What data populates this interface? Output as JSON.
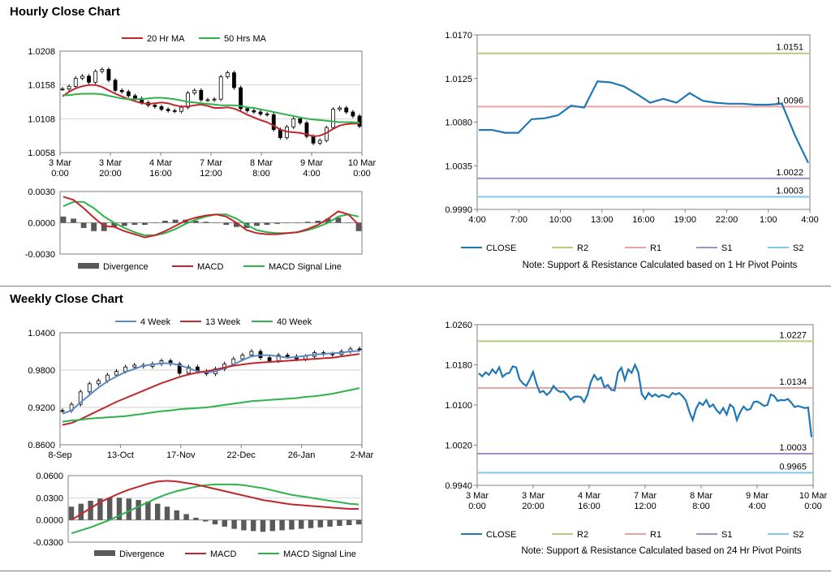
{
  "sections": {
    "hourly_title": "Hourly Close Chart",
    "weekly_title": "Weekly Close Chart"
  },
  "colors": {
    "ma20": "#c0272d",
    "ma50": "#2db34a",
    "wk4": "#5a8ac6",
    "wk13": "#c0272d",
    "wk40": "#2db34a",
    "close": "#1f77b4",
    "r2": "#b5cc7a",
    "r1": "#e7a3a3",
    "s1": "#a48fc0",
    "s2": "#7fc8e6",
    "divergence": "#595959",
    "macd": "#c0272d",
    "signal": "#2db34a"
  },
  "chart_data": [
    {
      "id": "hourly_price",
      "type": "candlestick",
      "title": "",
      "legend": [
        "20 Hr MA",
        "50 Hrs MA"
      ],
      "legend_placement": "top",
      "yticks": [
        "1.0208",
        "1.0158",
        "1.0108",
        "1.0058"
      ],
      "ylim": [
        1.0058,
        1.0208
      ],
      "xticks": [
        [
          "3 Mar",
          "0:00"
        ],
        [
          "3 Mar",
          "20:00"
        ],
        [
          "4 Mar",
          "16:00"
        ],
        [
          "7 Mar",
          "12:00"
        ],
        [
          "8 Mar",
          "8:00"
        ],
        [
          "9 Mar",
          "4:00"
        ],
        [
          "10 Mar",
          "0:00"
        ]
      ],
      "close": [
        1.0152,
        1.0156,
        1.0168,
        1.0171,
        1.0162,
        1.0178,
        1.0181,
        1.0165,
        1.015,
        1.0148,
        1.0142,
        1.0138,
        1.0132,
        1.0128,
        1.0126,
        1.0122,
        1.012,
        1.0119,
        1.0125,
        1.0146,
        1.015,
        1.0136,
        1.0136,
        1.0137,
        1.017,
        1.0176,
        1.0154,
        1.0123,
        1.012,
        1.0118,
        1.0115,
        1.0114,
        1.0092,
        1.008,
        1.0096,
        1.0108,
        1.0102,
        1.0082,
        1.0072,
        1.0076,
        1.0095,
        1.0122,
        1.0124,
        1.0118,
        1.0112,
        1.0097
      ],
      "ma20": [
        1.0141,
        1.0148,
        1.0153,
        1.0156,
        1.0158,
        1.0158,
        1.0155,
        1.015,
        1.0145,
        1.0141,
        1.0137,
        1.0134,
        1.0131,
        1.013,
        1.0131,
        1.0132,
        1.0131,
        1.0128,
        1.0126,
        1.0126,
        1.0128,
        1.0129,
        1.0127,
        1.0124,
        1.0124,
        1.0125,
        1.0123,
        1.0119,
        1.0114,
        1.011,
        1.0106,
        1.0103,
        1.0098,
        1.0092,
        1.0089,
        1.0088,
        1.0087,
        1.0085,
        1.0082,
        1.0083,
        1.0087,
        1.0093,
        1.0098,
        1.01,
        1.0101,
        1.0101
      ],
      "ma50": [
        1.0143,
        1.0143,
        1.0144,
        1.0145,
        1.0145,
        1.0145,
        1.0144,
        1.0142,
        1.014,
        1.0138,
        1.0137,
        1.0137,
        1.0137,
        1.0138,
        1.0139,
        1.0139,
        1.0138,
        1.0137,
        1.0135,
        1.0133,
        1.0132,
        1.0131,
        1.013,
        1.0129,
        1.0128,
        1.0128,
        1.0128,
        1.0127,
        1.0125,
        1.0124,
        1.0122,
        1.012,
        1.0118,
        1.0116,
        1.0114,
        1.0112,
        1.011,
        1.0108,
        1.0107,
        1.0106,
        1.0105,
        1.0104,
        1.0103,
        1.0103,
        1.0103,
        1.0102
      ]
    },
    {
      "id": "hourly_macd",
      "type": "line",
      "legend": [
        "Divergence",
        "MACD",
        "MACD Signal Line"
      ],
      "yticks": [
        "0.0030",
        "0.0000",
        "-0.0030"
      ],
      "ylim": [
        -0.003,
        0.003
      ],
      "macd": [
        0.0025,
        0.0022,
        0.0014,
        0.0005,
        -0.0003,
        -0.0004,
        -0.0008,
        -0.0011,
        -0.0014,
        -0.0012,
        -0.0008,
        -0.0003,
        0.0002,
        0.0005,
        0.0007,
        0.0008,
        0.0006,
        0.0,
        -0.0007,
        -0.001,
        -0.0011,
        -0.0011,
        -0.001,
        -0.0009,
        -0.0006,
        -0.0002,
        0.0004,
        0.0011,
        0.0008,
        -0.0002
      ],
      "signal": [
        0.0016,
        0.002,
        0.002,
        0.0014,
        0.0006,
        0.0,
        -0.0005,
        -0.0009,
        -0.0012,
        -0.0012,
        -0.001,
        -0.0006,
        -0.0001,
        0.0003,
        0.0006,
        0.0008,
        0.0008,
        0.0004,
        -0.0002,
        -0.0007,
        -0.0009,
        -0.001,
        -0.001,
        -0.0009,
        -0.0007,
        -0.0004,
        0.0,
        0.0006,
        0.0008,
        0.0006
      ],
      "divergence": [
        0.0006,
        0.0004,
        -0.0005,
        -0.0008,
        -0.0008,
        -0.0004,
        -0.0003,
        -0.0002,
        -0.0002,
        0.0,
        0.0002,
        0.0003,
        0.0003,
        0.0002,
        0.0001,
        0.0,
        -0.0002,
        -0.0004,
        -0.0005,
        -0.0003,
        -0.0002,
        -0.0001,
        0.0,
        0.0,
        0.0001,
        0.0002,
        0.0004,
        0.0005,
        0.0,
        -0.0008
      ]
    },
    {
      "id": "hourly_pivot",
      "type": "line",
      "legend": [
        "CLOSE",
        "R2",
        "R1",
        "S1",
        "S2"
      ],
      "note": "Note: Support & Resistance Calculated based on 1 Hr Pivot Points",
      "yticks": [
        "1.0170",
        "1.0125",
        "1.0080",
        "1.0035",
        "0.9990"
      ],
      "ylim": [
        0.999,
        1.017
      ],
      "xticks": [
        "4:00",
        "7:00",
        "10:00",
        "13:00",
        "16:00",
        "19:00",
        "22:00",
        "1:00",
        "4:00"
      ],
      "close": [
        1.0072,
        1.0072,
        1.0069,
        1.0069,
        1.0083,
        1.0084,
        1.0087,
        1.0097,
        1.0095,
        1.0122,
        1.0121,
        1.0117,
        1.0109,
        1.01,
        1.0104,
        1.01,
        1.011,
        1.0102,
        1.01,
        1.0099,
        1.0099,
        1.0098,
        1.0098,
        1.0099,
        1.0066,
        1.0038
      ],
      "levels": {
        "R2": 1.0151,
        "R1": 1.0096,
        "S1": 1.0022,
        "S2": 1.0003
      },
      "level_labels": {
        "R2": "1.0151",
        "R1": "1.0096",
        "S1": "1.0022",
        "S2": "1.0003"
      }
    },
    {
      "id": "weekly_price",
      "type": "candlestick",
      "legend": [
        "4 Week",
        "13 Week",
        "40 Week"
      ],
      "legend_placement": "top",
      "yticks": [
        "1.0400",
        "0.9800",
        "0.9200",
        "0.8600"
      ],
      "ylim": [
        0.86,
        1.04
      ],
      "xticks": [
        "8-Sep",
        "13-Oct",
        "17-Nov",
        "22-Dec",
        "26-Jan",
        "2-Mar"
      ],
      "close": [
        0.915,
        0.925,
        0.945,
        0.958,
        0.963,
        0.972,
        0.978,
        0.985,
        0.988,
        0.986,
        0.99,
        0.995,
        0.99,
        0.975,
        0.985,
        0.978,
        0.974,
        0.982,
        0.99,
        0.998,
        1.004,
        1.01,
        1.0,
        0.995,
        1.004,
        1.002,
        0.998,
        1.002,
        1.008,
        1.006,
        1.005,
        1.01,
        1.014,
        1.013
      ],
      "wk4": [
        0.91,
        0.915,
        0.928,
        0.94,
        0.952,
        0.962,
        0.97,
        0.977,
        0.982,
        0.987,
        0.989,
        0.991,
        0.991,
        0.988,
        0.983,
        0.978,
        0.976,
        0.978,
        0.983,
        0.989,
        0.996,
        1.002,
        1.004,
        1.004,
        1.002,
        1.0,
        1.001,
        1.003,
        1.005,
        1.006,
        1.007,
        1.008,
        1.01,
        1.011
      ],
      "wk13": [
        0.892,
        0.895,
        0.901,
        0.908,
        0.915,
        0.922,
        0.929,
        0.935,
        0.941,
        0.947,
        0.953,
        0.959,
        0.964,
        0.969,
        0.973,
        0.976,
        0.978,
        0.981,
        0.984,
        0.987,
        0.989,
        0.991,
        0.992,
        0.993,
        0.994,
        0.995,
        0.996,
        0.997,
        0.998,
        0.999,
        1.0,
        1.002,
        1.004,
        1.006
      ],
      "wk40": [
        0.897,
        0.899,
        0.9,
        0.902,
        0.903,
        0.904,
        0.905,
        0.906,
        0.908,
        0.91,
        0.912,
        0.914,
        0.915,
        0.917,
        0.918,
        0.919,
        0.92,
        0.922,
        0.924,
        0.926,
        0.928,
        0.93,
        0.931,
        0.932,
        0.933,
        0.934,
        0.935,
        0.937,
        0.938,
        0.94,
        0.942,
        0.945,
        0.948,
        0.951
      ]
    },
    {
      "id": "weekly_macd",
      "type": "line",
      "legend": [
        "Divergence",
        "MACD",
        "MACD Signal Line"
      ],
      "yticks": [
        "0.0600",
        "0.0300",
        "0.0000",
        "-0.0300"
      ],
      "ylim": [
        -0.03,
        0.06
      ],
      "macd": [
        0.0,
        0.008,
        0.016,
        0.024,
        0.03,
        0.036,
        0.041,
        0.045,
        0.049,
        0.052,
        0.053,
        0.052,
        0.05,
        0.048,
        0.045,
        0.042,
        0.039,
        0.036,
        0.033,
        0.03,
        0.027,
        0.025,
        0.023,
        0.021,
        0.02,
        0.019,
        0.018,
        0.017,
        0.016,
        0.015,
        0.015
      ],
      "signal": [
        -0.018,
        -0.014,
        -0.01,
        -0.005,
        0.0,
        0.006,
        0.012,
        0.018,
        0.024,
        0.03,
        0.035,
        0.039,
        0.042,
        0.045,
        0.047,
        0.048,
        0.048,
        0.048,
        0.047,
        0.045,
        0.043,
        0.04,
        0.037,
        0.034,
        0.032,
        0.03,
        0.028,
        0.026,
        0.024,
        0.022,
        0.021
      ],
      "divergence": [
        0.018,
        0.022,
        0.026,
        0.029,
        0.03,
        0.03,
        0.029,
        0.027,
        0.025,
        0.022,
        0.018,
        0.013,
        0.008,
        0.003,
        -0.002,
        -0.006,
        -0.009,
        -0.012,
        -0.014,
        -0.015,
        -0.016,
        -0.015,
        -0.014,
        -0.013,
        -0.012,
        -0.011,
        -0.01,
        -0.009,
        -0.008,
        -0.007,
        -0.006
      ]
    },
    {
      "id": "weekly_pivot",
      "type": "line",
      "legend": [
        "CLOSE",
        "R2",
        "R1",
        "S1",
        "S2"
      ],
      "note": "Note: Support & Resistance Calculated based on 24 Hr Pivot Points",
      "yticks": [
        "1.0260",
        "1.0180",
        "1.0100",
        "1.0020",
        "0.9940"
      ],
      "ylim": [
        0.994,
        1.026
      ],
      "xticks": [
        [
          "3 Mar",
          "0:00"
        ],
        [
          "3 Mar",
          "20:00"
        ],
        [
          "4 Mar",
          "16:00"
        ],
        [
          "7 Mar",
          "12:00"
        ],
        [
          "8 Mar",
          "8:00"
        ],
        [
          "9 Mar",
          "4:00"
        ],
        [
          "10 Mar",
          "0:00"
        ]
      ],
      "close": [
        1.0163,
        1.0157,
        1.0165,
        1.016,
        1.0171,
        1.0163,
        1.0175,
        1.0156,
        1.0162,
        1.0164,
        1.0177,
        1.0175,
        1.0151,
        1.0143,
        1.0138,
        1.0151,
        1.0166,
        1.0142,
        1.0125,
        1.0128,
        1.012,
        1.0126,
        1.0138,
        1.013,
        1.0126,
        1.0127,
        1.012,
        1.011,
        1.0116,
        1.0117,
        1.0116,
        1.0106,
        1.012,
        1.0146,
        1.016,
        1.015,
        1.0155,
        1.0135,
        1.014,
        1.013,
        1.0129,
        1.0165,
        1.0174,
        1.015,
        1.0171,
        1.0164,
        1.018,
        1.0165,
        1.0122,
        1.0112,
        1.0124,
        1.0117,
        1.0121,
        1.0116,
        1.012,
        1.0118,
        1.0115,
        1.0124,
        1.0121,
        1.0124,
        1.0118,
        1.0109,
        1.0087,
        1.007,
        1.0093,
        1.0105,
        1.01,
        1.011,
        1.0096,
        1.0101,
        1.009,
        1.0083,
        1.0094,
        1.0081,
        1.0101,
        1.0095,
        1.007,
        1.0086,
        1.0097,
        1.009,
        1.0092,
        1.0106,
        1.0107,
        1.0103,
        1.0098,
        1.01,
        1.0121,
        1.0118,
        1.0108,
        1.011,
        1.0109,
        1.0112,
        1.0105,
        1.0096,
        1.0098,
        1.0096,
        1.0094,
        1.0095,
        1.0036
      ],
      "levels": {
        "R2": 1.0227,
        "R1": 1.0134,
        "S1": 1.0003,
        "S2": 0.9965
      },
      "level_labels": {
        "R2": "1.0227",
        "R1": "1.0134",
        "S1": "1.0003",
        "S2": "0.9965"
      }
    }
  ]
}
